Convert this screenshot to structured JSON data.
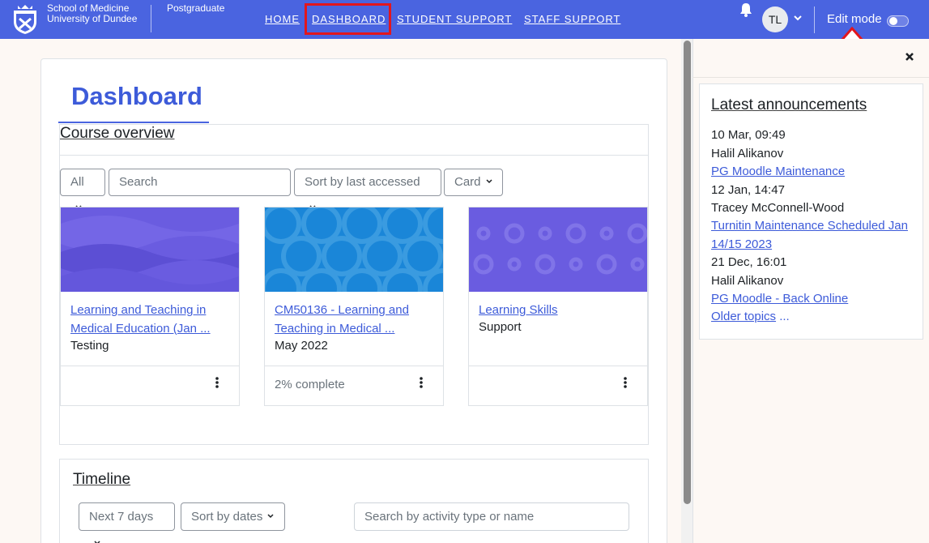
{
  "navbar": {
    "brand_line1": "School of Medicine",
    "brand_line2": "University of Dundee",
    "brand_sub": "Postgraduate",
    "links": [
      {
        "label": "HOME"
      },
      {
        "label": "DASHBOARD"
      },
      {
        "label": "STUDENT SUPPORT"
      },
      {
        "label": "STAFF SUPPORT"
      }
    ],
    "avatar_initials": "TL",
    "edit_mode_label": "Edit mode",
    "colors": {
      "bar": "#4a64e0",
      "highlight": "#e3161d"
    }
  },
  "page": {
    "title": "Dashboard"
  },
  "course_overview": {
    "title": "Course overview",
    "filter_label": "All",
    "search_placeholder": "Search",
    "sort_label": "Sort by last accessed",
    "view_label": "Card",
    "courses": [
      {
        "name": "Learning and Teaching in Medical Education (Jan ...",
        "category": "Testing",
        "progress": ""
      },
      {
        "name": "CM50136 - Learning and Teaching in Medical ...",
        "category": "May 2022",
        "progress": "2% complete"
      },
      {
        "name": "Learning Skills",
        "category": "Support",
        "progress": ""
      }
    ]
  },
  "timeline": {
    "title": "Timeline",
    "range_label": "Next 7 days",
    "sort_label": "Sort by dates",
    "search_placeholder": "Search by activity type or name"
  },
  "announcements": {
    "title": "Latest announcements",
    "items": [
      {
        "date": "10 Mar, 09:49",
        "author": "Halil Alikanov",
        "subject": "PG Moodle Maintenance "
      },
      {
        "date": "12 Jan, 14:47",
        "author": "Tracey McConnell-Wood",
        "subject": "Turnitin Maintenance Scheduled Jan 14/15 2023"
      },
      {
        "date": "21 Dec, 16:01",
        "author": "Halil Alikanov",
        "subject": "PG Moodle - Back Online"
      }
    ],
    "older_label": "Older topics",
    "older_suffix": " ..."
  }
}
